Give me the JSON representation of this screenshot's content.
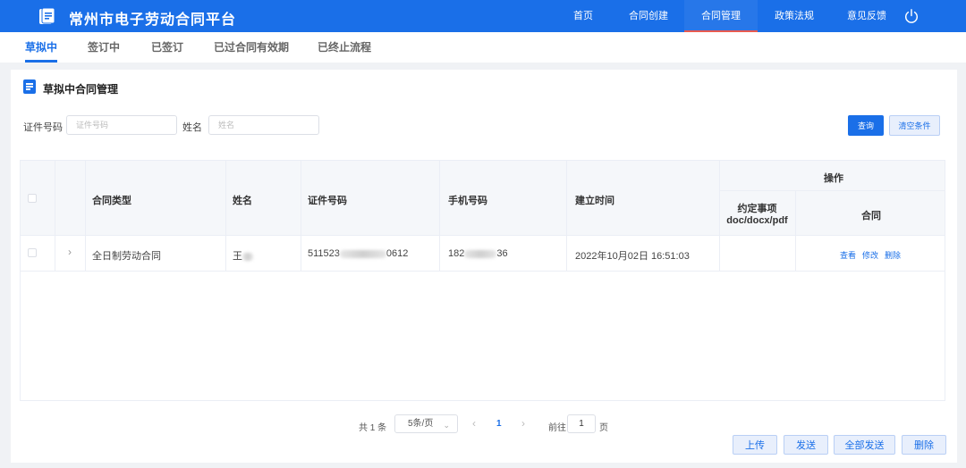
{
  "app": {
    "title": "常州市电子劳动合同平台"
  },
  "nav": {
    "items": [
      {
        "label": "首页"
      },
      {
        "label": "合同创建"
      },
      {
        "label": "合同管理"
      },
      {
        "label": "政策法规"
      },
      {
        "label": "意见反馈"
      }
    ],
    "active_index": 2
  },
  "tabs": [
    {
      "label": "草拟中"
    },
    {
      "label": "签订中"
    },
    {
      "label": "已签订"
    },
    {
      "label": "已过合同有效期"
    },
    {
      "label": "已终止流程"
    }
  ],
  "panel": {
    "title": "草拟中合同管理"
  },
  "search": {
    "id_label": "证件号码",
    "id_placeholder": "证件号码",
    "name_label": "姓名",
    "name_placeholder": "姓名",
    "query_button": "查询",
    "clear_button": "清空条件"
  },
  "table": {
    "headers": {
      "type": "合同类型",
      "name": "姓名",
      "id": "证件号码",
      "phone": "手机号码",
      "created": "建立时间",
      "ops": "操作",
      "agreement": "约定事项",
      "agreement_formats": "doc/docx/pdf",
      "contract": "合同"
    },
    "rows": [
      {
        "type": "全日制劳动合同",
        "name_prefix": "王",
        "id_prefix": "511523",
        "id_suffix": "0612",
        "phone_prefix": "182",
        "phone_suffix": "36",
        "created": "2022年10月02日 16:51:03",
        "actions": {
          "view": "查看",
          "edit": "修改",
          "delete": "删除"
        }
      }
    ]
  },
  "pagination": {
    "total_prefix": "共",
    "total_count": "1",
    "total_suffix": "条",
    "page_size": "5条/页",
    "current_page": "1",
    "goto_prefix": "前往",
    "goto_value": "1",
    "goto_suffix": "页"
  },
  "actions": {
    "upload": "上传",
    "send": "发送",
    "send_all": "全部发送",
    "delete": "删除"
  },
  "colors": {
    "primary": "#1a6fe8",
    "active_nav_underline": "#e85a4f"
  }
}
